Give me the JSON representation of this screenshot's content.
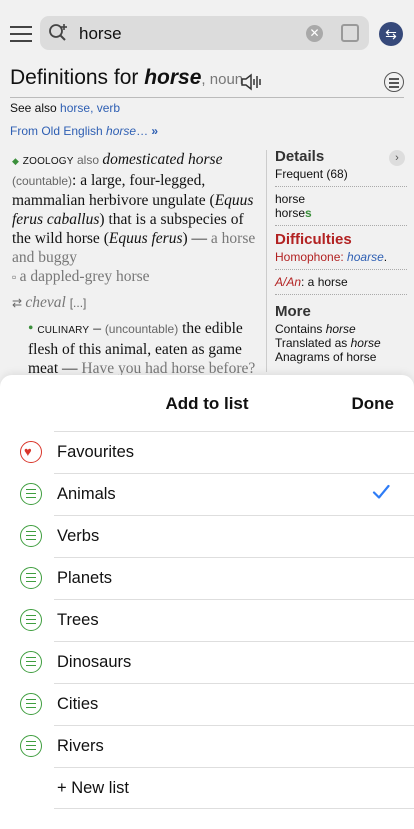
{
  "search": {
    "query": "horse"
  },
  "page": {
    "title_prefix": "Definitions for ",
    "title_word": "horse",
    "title_pos": ", noun",
    "see_also_label": "See also ",
    "see_also_links": "horse, verb",
    "origin_text": "From Old English ",
    "origin_word": "horse",
    "origin_more": "…",
    "origin_arrow": "»"
  },
  "definitions": {
    "d1_label": "ZOOLOGY",
    "d1_also": " also ",
    "d1_also_term": "domesticated horse",
    "d1_grammar": "(countable)",
    "d1_text_a": ": a large, four-legged, mammalian herbivore ungulate (",
    "d1_sci1": "Equus ferus caballus",
    "d1_text_b": ") that is a subspecies of the wild horse (",
    "d1_sci2": "Equus ferus",
    "d1_text_c": ") — ",
    "d1_example1": "a horse and buggy",
    "d1_example2": "a dappled-grey horse",
    "d1_translation": "cheval",
    "d1_more": "[...]",
    "d2_label": "CULINARY",
    "d2_grammar": "(uncountable)",
    "d2_text": " the edible flesh of this animal, eaten as game meat — ",
    "d2_example": "Have you had horse before?"
  },
  "sidebar": {
    "details_heading": "Details",
    "frequency": "Frequent (68)",
    "form1": "horse",
    "form2_stem": "horse",
    "form2_suffix": "s",
    "difficulties_heading": "Difficulties",
    "homophone_label": "Homophone: ",
    "homophone_word": "hoarse",
    "homophone_end": ".",
    "an_label": "A/An",
    "an_text": ": a horse",
    "more_heading": "More",
    "contains_label": "Contains ",
    "contains_word": "horse",
    "translated_label": "Translated as ",
    "translated_word": "horse",
    "anagrams_text": "Anagrams of horse"
  },
  "sheet": {
    "title": "Add to list",
    "done_label": "Done",
    "items": [
      {
        "label": "Favourites",
        "icon": "heart-icon",
        "checked": false
      },
      {
        "label": "Animals",
        "icon": "list-icon",
        "checked": true
      },
      {
        "label": "Verbs",
        "icon": "list-icon",
        "checked": false
      },
      {
        "label": "Planets",
        "icon": "list-icon",
        "checked": false
      },
      {
        "label": "Trees",
        "icon": "list-icon",
        "checked": false
      },
      {
        "label": "Dinosaurs",
        "icon": "list-icon",
        "checked": false
      },
      {
        "label": "Cities",
        "icon": "list-icon",
        "checked": false
      },
      {
        "label": "Rivers",
        "icon": "list-icon",
        "checked": false
      }
    ],
    "new_list_label": "+ New list"
  },
  "colors": {
    "accent_blue": "#2e7cf6",
    "list_green": "#3f9e3f",
    "favourite_red": "#d9352a",
    "difficulty_red": "#b22222"
  }
}
